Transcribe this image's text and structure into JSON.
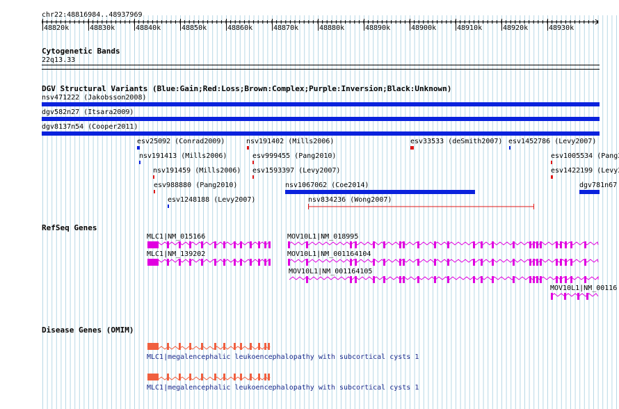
{
  "region": "chr22:48816984..48937969",
  "ruler": {
    "ticks": [
      "48820k",
      "48830k",
      "48840k",
      "48850k",
      "48860k",
      "48870k",
      "48880k",
      "48890k",
      "48900k",
      "48910k",
      "48920k",
      "48930k"
    ]
  },
  "tracks": {
    "cytoband": {
      "title": "Cytogenetic Bands",
      "band": "22q13.33"
    },
    "dgv": {
      "title": "DGV Structural Variants (Blue:Gain;Red:Loss;Brown:Complex;Purple:Inversion;Black:Unknown)",
      "colors": {
        "gain": "#0a22dd",
        "loss": "#e01818",
        "complex": "#8b4513",
        "inversion": "#800080",
        "unknown": "#000000"
      },
      "features": [
        {
          "label": "nsv471222 (Jakobsson2008)",
          "type": "gain"
        },
        {
          "label": "dgv582n27 (Itsara2009)",
          "type": "gain"
        },
        {
          "label": "dgv8137n54 (Cooper2011)",
          "type": "gain"
        },
        {
          "label": "esv25092 (Conrad2009)",
          "type": "gain"
        },
        {
          "label": "nsv191402 (Mills2006)",
          "type": "loss"
        },
        {
          "label": "esv33533 (deSmith2007)",
          "type": "loss"
        },
        {
          "label": "esv1452786 (Levy2007)",
          "type": "gain"
        },
        {
          "label": "nsv191413 (Mills2006)",
          "type": "gain"
        },
        {
          "label": "esv999455 (Pang2010)",
          "type": "loss"
        },
        {
          "label": "esv1005534 (Pang2",
          "type": "loss"
        },
        {
          "label": "nsv191459 (Mills2006)",
          "type": "loss"
        },
        {
          "label": "esv1593397 (Levy2007)",
          "type": "loss"
        },
        {
          "label": "esv1422199 (Levy2",
          "type": "loss"
        },
        {
          "label": "esv988880 (Pang2010)",
          "type": "loss"
        },
        {
          "label": "nsv1067062 (Coe2014)",
          "type": "gain"
        },
        {
          "label": "dgv781n67",
          "type": "gain"
        },
        {
          "label": "esv1248188 (Levy2007)",
          "type": "gain"
        },
        {
          "label": "nsv834236 (Wong2007)",
          "type": "loss"
        }
      ]
    },
    "refseq": {
      "title": "RefSeq Genes",
      "color": "#e000e0",
      "genes": [
        {
          "label": "MLC1|NM_015166"
        },
        {
          "label": "MOV10L1|NM_018995"
        },
        {
          "label": "MLC1|NM_139202"
        },
        {
          "label": "MOV10L1|NM_001164104"
        },
        {
          "label": "MOV10L1|NM_001164105"
        },
        {
          "label": "MOV10L1|NM_00116"
        }
      ]
    },
    "omim": {
      "title": "Disease Genes (OMIM)",
      "color": "#f06040",
      "genes": [
        {
          "label": "MLC1|megalencephalic leukoencephalopathy with subcortical cysts 1"
        },
        {
          "label": "MLC1|megalencephalic leukoencephalopathy with subcortical cysts 1"
        }
      ]
    }
  }
}
